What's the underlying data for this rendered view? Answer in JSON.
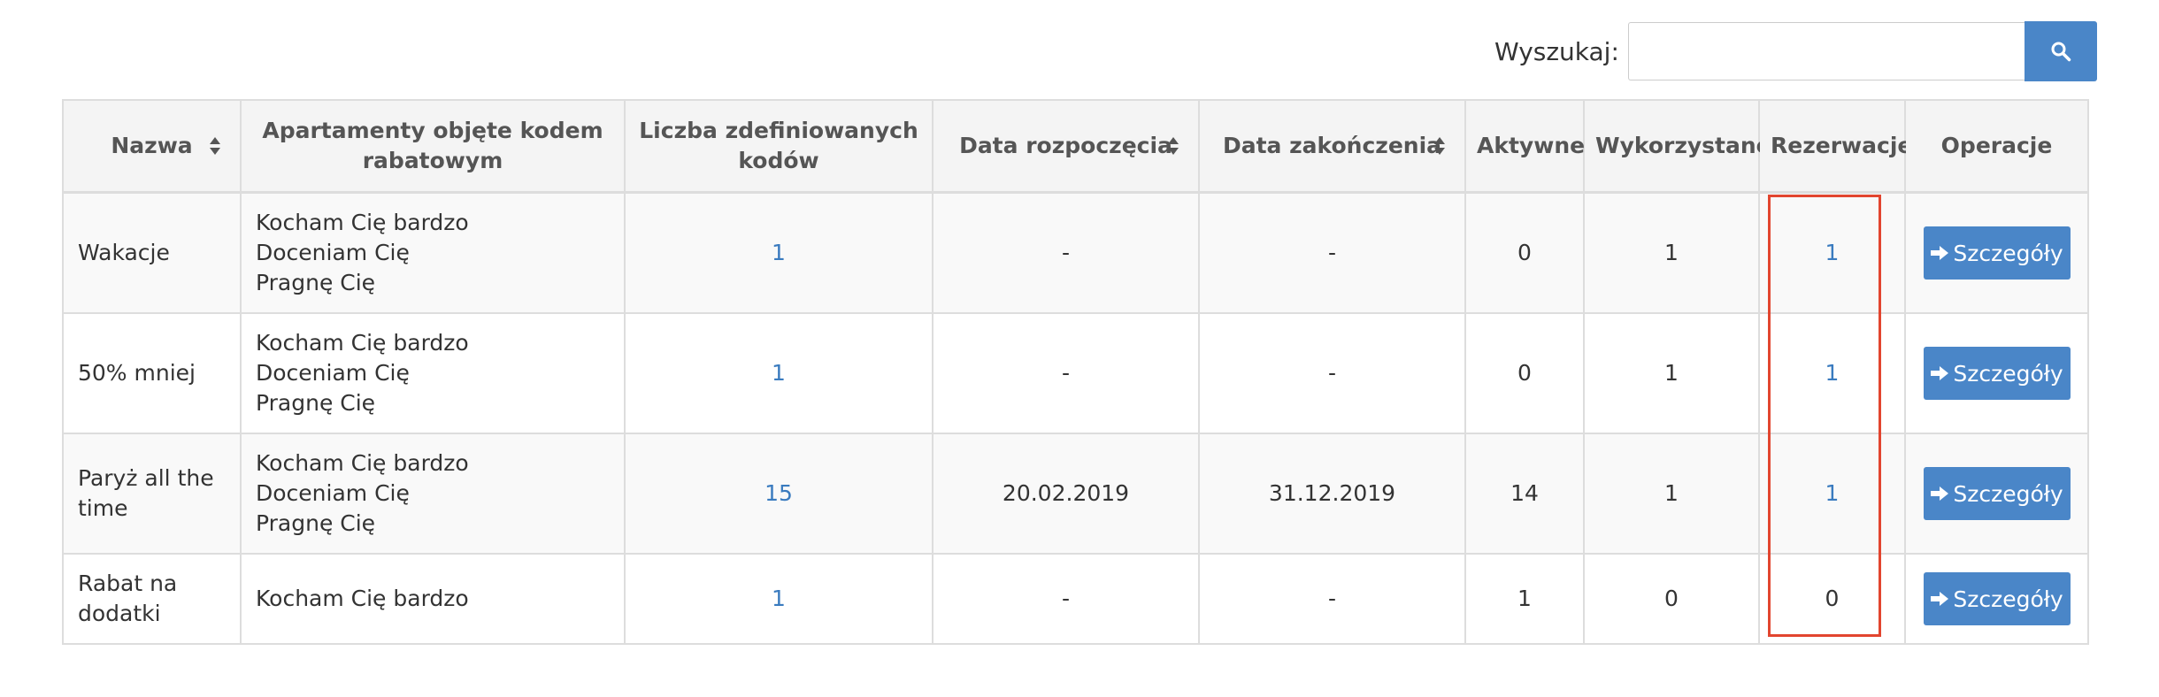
{
  "search": {
    "label": "Wyszukaj:",
    "placeholder": "",
    "value": ""
  },
  "table": {
    "headers": {
      "nazwa": "Nazwa",
      "apartamenty": "Apartamenty objęte kodem rabatowym",
      "liczba": "Liczba zdefiniowanych kodów",
      "data_rozpoczecia": "Data rozpoczęcia",
      "data_zakonczenia": "Data zakończenia",
      "aktywne": "Aktywne",
      "wykorzystane": "Wykorzystane",
      "rezerwacje": "Rezerwacje",
      "operacje": "Operacje"
    },
    "rows": [
      {
        "name": "Wakacje",
        "apartments": [
          "Kocham Cię bardzo",
          "Doceniam Cię",
          "Pragnę Cię"
        ],
        "codes": "1",
        "start": "-",
        "end": "-",
        "active": "0",
        "used": "1",
        "reservations": "1",
        "action": "Szczegóły"
      },
      {
        "name": "50% mniej",
        "apartments": [
          "Kocham Cię bardzo",
          "Doceniam Cię",
          "Pragnę Cię"
        ],
        "codes": "1",
        "start": "-",
        "end": "-",
        "active": "0",
        "used": "1",
        "reservations": "1",
        "action": "Szczegóły"
      },
      {
        "name": "Paryż all the time",
        "apartments": [
          "Kocham Cię bardzo",
          "Doceniam Cię",
          "Pragnę Cię"
        ],
        "codes": "15",
        "start": "20.02.2019",
        "end": "31.12.2019",
        "active": "14",
        "used": "1",
        "reservations": "1",
        "action": "Szczegóły"
      },
      {
        "name": "Rabat na dodatki",
        "apartments": [
          "Kocham Cię bardzo"
        ],
        "codes": "1",
        "start": "-",
        "end": "-",
        "active": "1",
        "used": "0",
        "reservations": "0",
        "action": "Szczegóły"
      }
    ]
  },
  "colors": {
    "accent": "#4a86c8",
    "link": "#3a7bbf",
    "highlight": "#e2452f"
  },
  "icons": {
    "search": "search-icon",
    "sort": "sort-icon",
    "details": "arrow-right-icon"
  }
}
